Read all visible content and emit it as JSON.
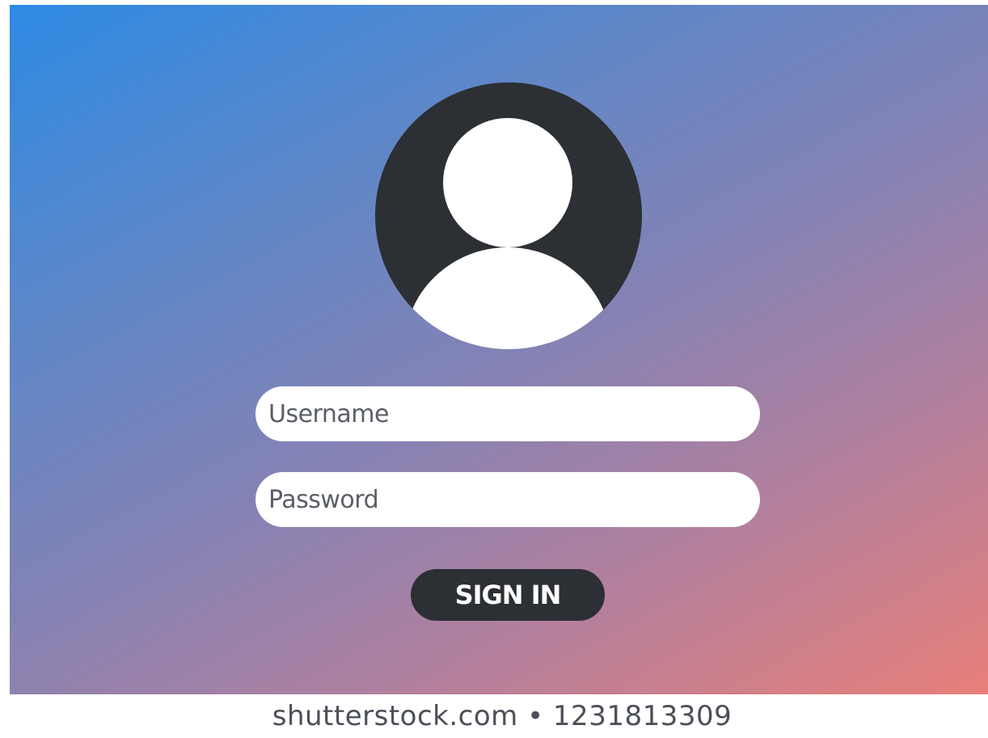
{
  "login": {
    "avatar_icon": "user-avatar-icon",
    "username_placeholder": "Username",
    "password_placeholder": "Password",
    "signin_label": "SIGN IN"
  },
  "watermark": {
    "text": "shutterstock.com • 1231813309"
  },
  "colors": {
    "gradient_start": "#2d8ae3",
    "gradient_end": "#e77f79",
    "avatar_bg": "#2c2f33",
    "button_bg": "#2c2f33",
    "field_bg": "#ffffff"
  }
}
